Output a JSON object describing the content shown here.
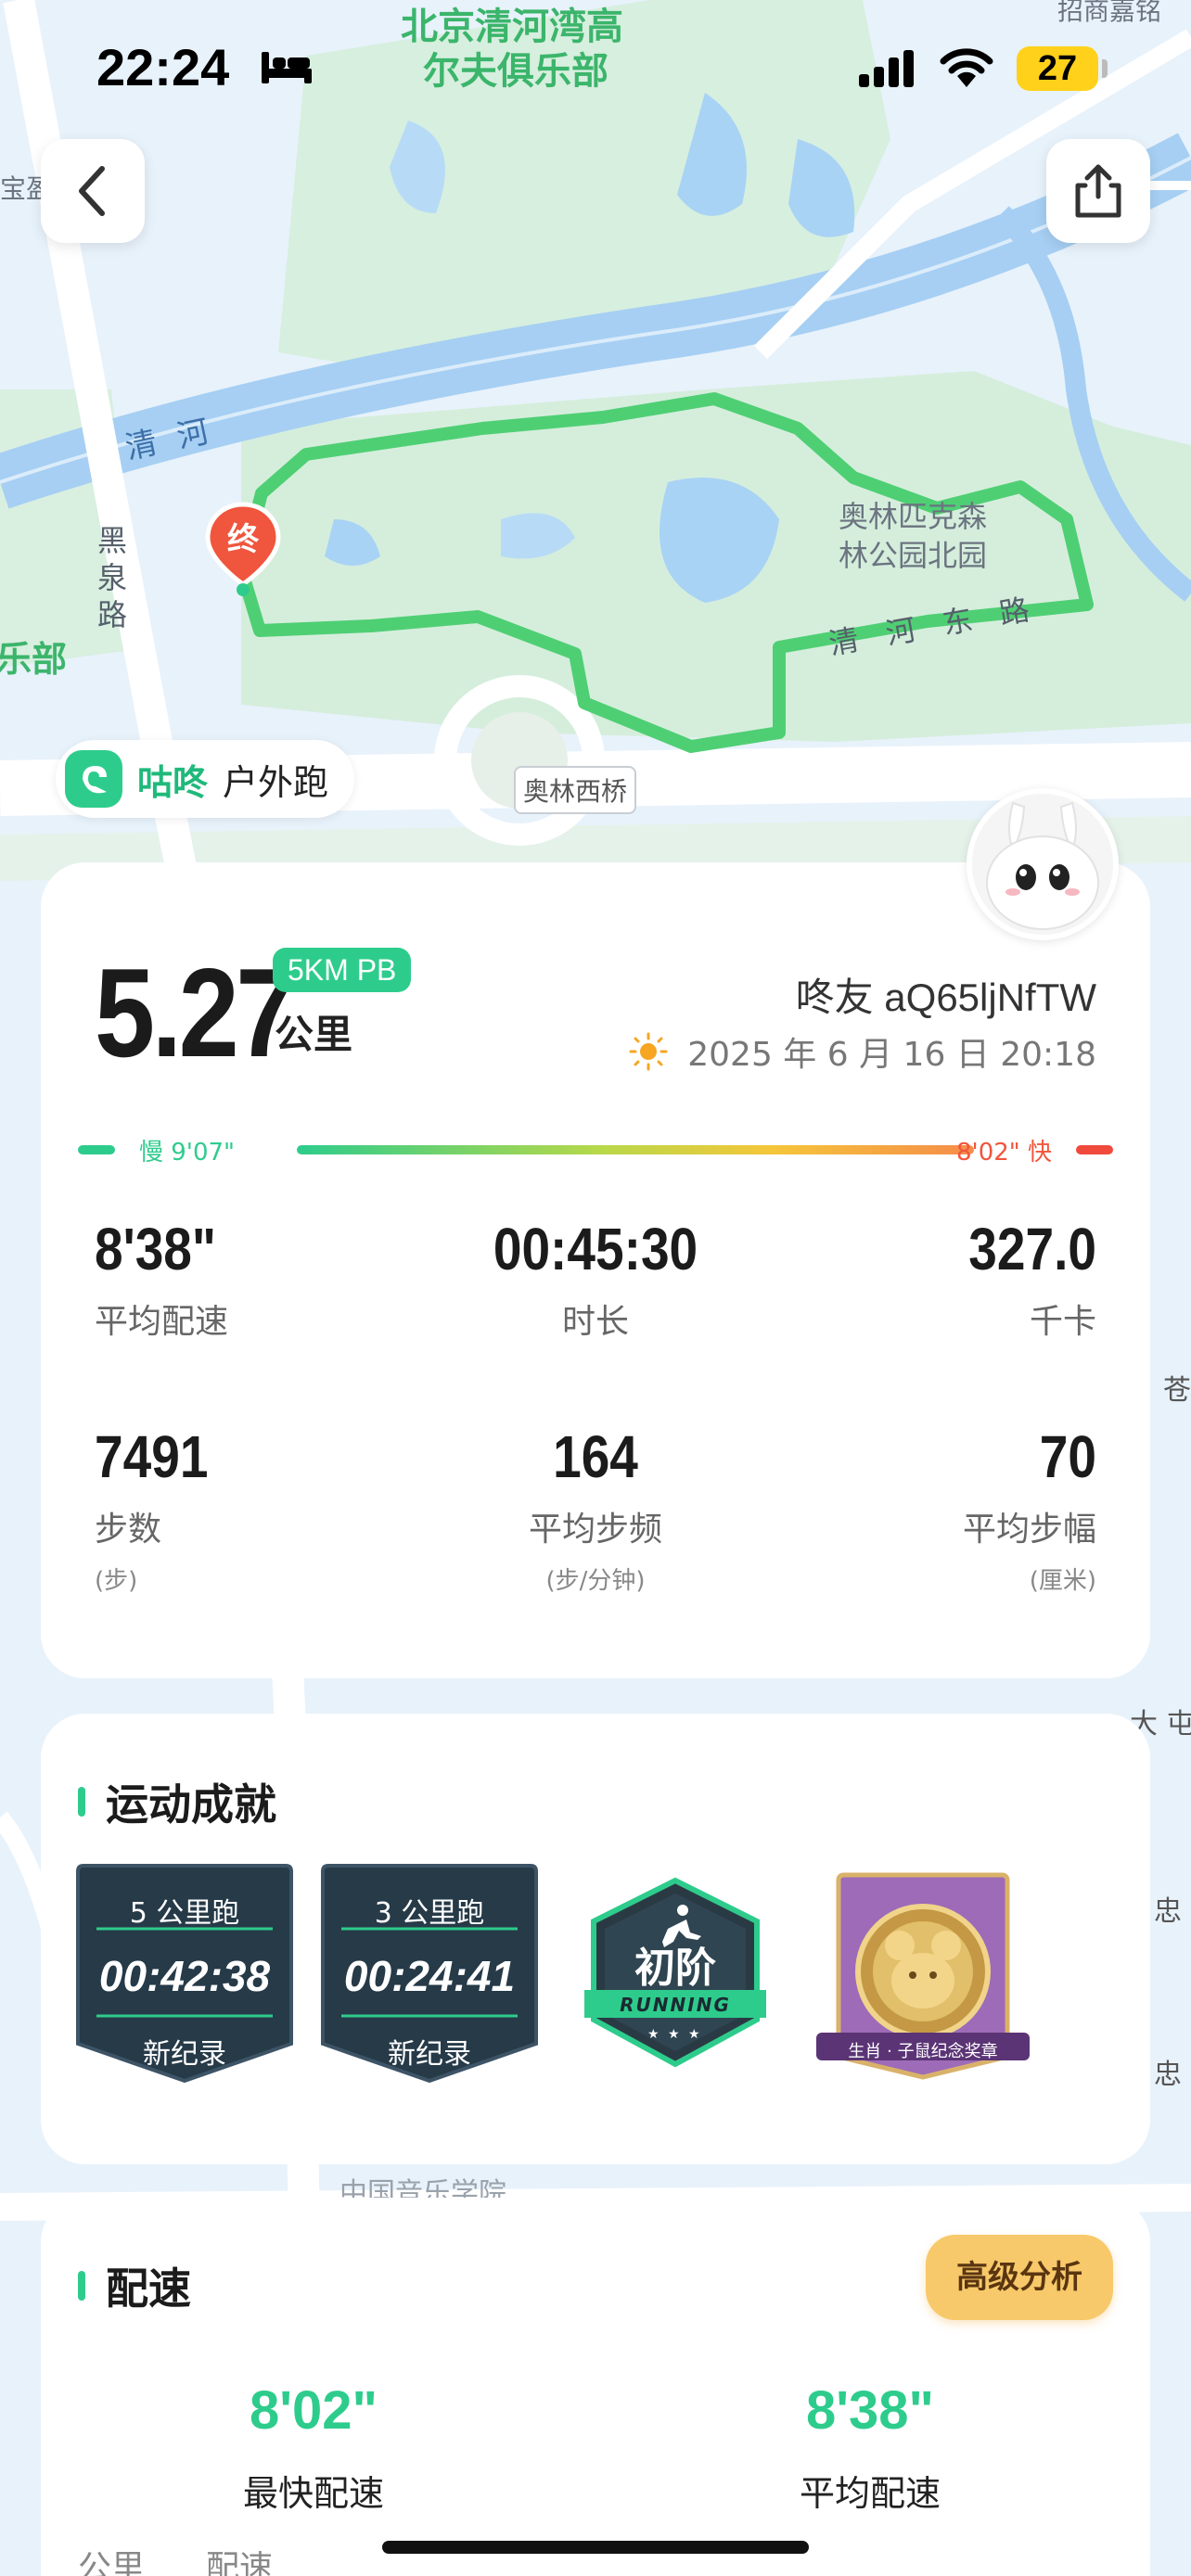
{
  "status_bar": {
    "time": "22:24",
    "battery": "27"
  },
  "map": {
    "labels": {
      "golf_club_1": "北京清河湾高",
      "golf_club_2": "尔夫俱乐部",
      "river": "清 河",
      "road_left": "黑泉路",
      "park_1": "奥林匹克森",
      "park_2": "林公园北园",
      "road_east": "清 河 东 路",
      "bridge": "奥林西桥",
      "left_edge_1": "宝盈",
      "left_edge_2": "乐部",
      "top_right": "招商嘉铭",
      "conservatory": "中国音乐学院",
      "right_edge_1": "大 屯",
      "right_edge_2": "忠",
      "right_edge_3": "忠",
      "right_edge_4": "苍"
    },
    "marker": "终",
    "route_color": "#3dd07a"
  },
  "brand": {
    "name": "咕咚",
    "subtitle": "户外跑"
  },
  "summary": {
    "distance": "5.27",
    "pb_badge": "5KM PB",
    "unit": "公里",
    "username": "咚友 aQ65ljNfTW",
    "datetime": "2025 年 6 月 16 日 20:18",
    "pace_bar": {
      "slow_label": "慢 9'07\"",
      "fast_label": "8'02\" 快"
    },
    "stats": [
      {
        "value": "8'38\"",
        "label": "平均配速",
        "sub": ""
      },
      {
        "value": "00:45:30",
        "label": "时长",
        "sub": ""
      },
      {
        "value": "327.0",
        "label": "千卡",
        "sub": ""
      },
      {
        "value": "7491",
        "label": "步数",
        "sub": "(步)"
      },
      {
        "value": "164",
        "label": "平均步频",
        "sub": "(步/分钟)"
      },
      {
        "value": "70",
        "label": "平均步幅",
        "sub": "(厘米)"
      }
    ]
  },
  "achievements": {
    "title": "运动成就",
    "records": [
      {
        "title": "5 公里跑",
        "time": "00:42:38",
        "tag": "新纪录"
      },
      {
        "title": "3 公里跑",
        "time": "00:24:41",
        "tag": "新纪录"
      }
    ],
    "level_badge": {
      "title": "初阶",
      "subtitle": "RUNNING"
    },
    "medal": {
      "label": "生肖 · 子鼠纪念奖章"
    }
  },
  "pace": {
    "title": "配速",
    "advanced_button": "高级分析",
    "fastest": {
      "value": "8'02\"",
      "label": "最快配速"
    },
    "average": {
      "value": "8'38\"",
      "label": "平均配速"
    },
    "tabs": [
      "公里",
      "配速"
    ]
  },
  "colors": {
    "accent": "#2ecc8c",
    "fast": "#f04a3c",
    "advanced": "#f7c96a",
    "badge_dark": "#263a48"
  }
}
